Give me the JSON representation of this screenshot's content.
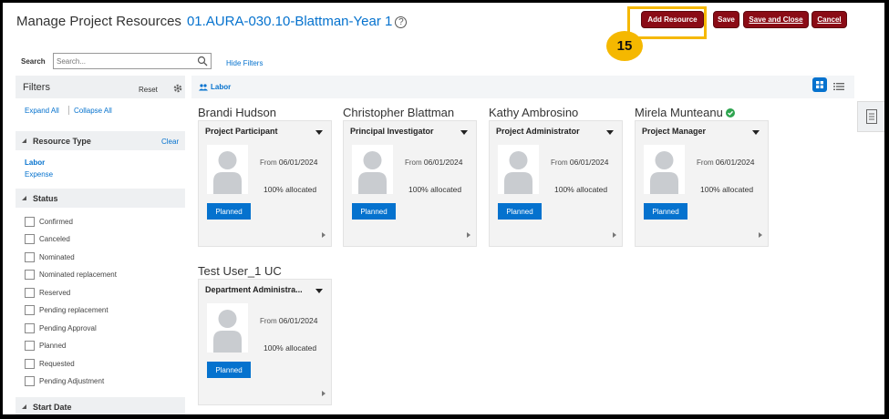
{
  "page": {
    "title": "Manage Project Resources",
    "project": "01.AURA-030.10-Blattman-Year 1",
    "help_glyph": "?"
  },
  "toolbar": {
    "add_resource": "Add Resource",
    "save": "Save",
    "save_and_close": "Save and Close",
    "cancel": "Cancel"
  },
  "annotation": {
    "step": "15",
    "color": "#f5b800"
  },
  "search": {
    "label": "Search",
    "placeholder": "Search...",
    "value": ""
  },
  "hide_filters": "Hide Filters",
  "filters": {
    "title": "Filters",
    "reset": "Reset",
    "expand_all": "Expand All",
    "collapse_all": "Collapse All",
    "resource_type": {
      "label": "Resource Type",
      "clear": "Clear",
      "items": [
        "Labor",
        "Expense"
      ]
    },
    "status": {
      "label": "Status",
      "items": [
        "Confirmed",
        "Canceled",
        "Nominated",
        "Nominated replacement",
        "Reserved",
        "Pending replacement",
        "Pending Approval",
        "Planned",
        "Requested",
        "Pending Adjustment"
      ]
    },
    "start_date": {
      "label": "Start Date"
    }
  },
  "main": {
    "tab_label": "Labor",
    "resources": [
      {
        "name": "Brandi Hudson",
        "role": "Project Participant",
        "from_label": "From",
        "from_date": "06/01/2024",
        "allocation": "100% allocated",
        "status": "Planned",
        "verified": false
      },
      {
        "name": "Christopher Blattman",
        "role": "Principal Investigator",
        "from_label": "From",
        "from_date": "06/01/2024",
        "allocation": "100% allocated",
        "status": "Planned",
        "verified": false
      },
      {
        "name": "Kathy Ambrosino",
        "role": "Project Administrator",
        "from_label": "From",
        "from_date": "06/01/2024",
        "allocation": "100% allocated",
        "status": "Planned",
        "verified": false
      },
      {
        "name": "Mirela Munteanu",
        "role": "Project Manager",
        "from_label": "From",
        "from_date": "06/01/2024",
        "allocation": "100% allocated",
        "status": "Planned",
        "verified": true
      },
      {
        "name": "Test User_1 UC",
        "role": "Department Administra...",
        "from_label": "From",
        "from_date": "06/01/2024",
        "allocation": "100% allocated",
        "status": "Planned",
        "verified": false
      }
    ]
  },
  "colors": {
    "accent": "#0572ce",
    "button": "#8b0c16",
    "verified": "#2ea44f"
  }
}
